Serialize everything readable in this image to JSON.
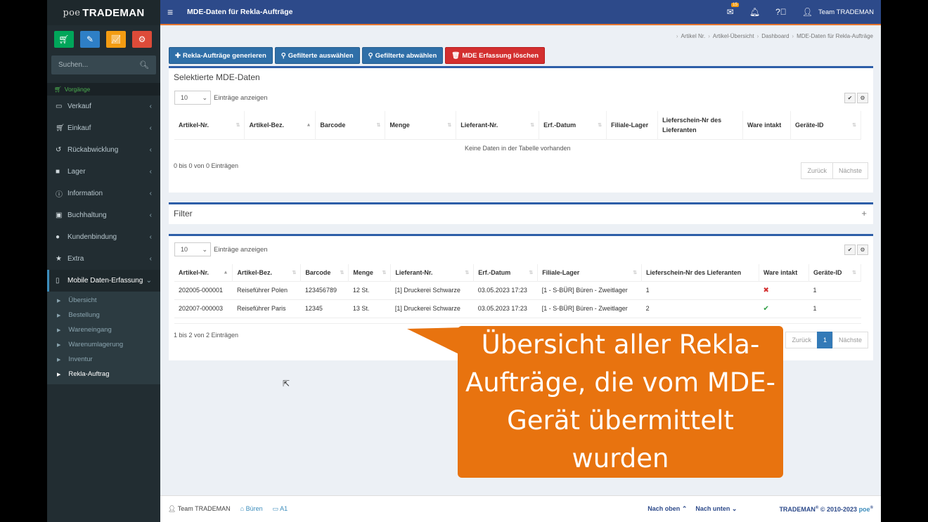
{
  "sidebar": {
    "logo_prefix": "poe",
    "logo_brand": "TRADEMAN",
    "search_placeholder": "Suchen...",
    "group_label": "Vorgänge",
    "items": [
      {
        "label": "Verkauf",
        "icon": "monitor-icon"
      },
      {
        "label": "Einkauf",
        "icon": "cart-icon"
      },
      {
        "label": "Rückabwicklung",
        "icon": "undo-icon"
      },
      {
        "label": "Lager",
        "icon": "truck-icon"
      },
      {
        "label": "Information",
        "icon": "info-icon"
      },
      {
        "label": "Buchhaltung",
        "icon": "money-icon"
      },
      {
        "label": "Kundenbindung",
        "icon": "users-icon"
      },
      {
        "label": "Extra",
        "icon": "star-icon"
      },
      {
        "label": "Mobile Daten-Erfassung",
        "icon": "mobile-icon"
      }
    ],
    "subitems": [
      "Übersicht",
      "Bestellung",
      "Wareneingang",
      "Warenumlagerung",
      "Inventur",
      "Rekla-Auftrag"
    ]
  },
  "header": {
    "title": "MDE-Daten für Rekla-Aufträge",
    "mail_badge": "15",
    "user": "Team TRADEMAN"
  },
  "breadcrumb": [
    "Artikel Nr.",
    "Artikel-Übersicht",
    "Dashboard",
    "MDE-Daten für Rekla-Aufträge"
  ],
  "actions": {
    "generate": "Rekla-Aufträge generieren",
    "select_filtered": "Gefilterte auswählen",
    "deselect_filtered": "Gefilterte abwählen",
    "delete_mde": "MDE Erfassung löschen"
  },
  "selected_box": {
    "title": "Selektierte MDE-Daten",
    "page_length": "10",
    "length_label": "Einträge anzeigen",
    "columns": [
      "Artikel-Nr.",
      "Artikel-Bez.",
      "Barcode",
      "Menge",
      "Lieferant-Nr.",
      "Erf.-Datum",
      "Filiale-Lager",
      "Lieferschein-Nr des Lieferanten",
      "Ware intakt",
      "Geräte-ID"
    ],
    "empty": "Keine Daten in der Tabelle vorhanden",
    "info": "0 bis 0 von 0 Einträgen",
    "prev": "Zurück",
    "next": "Nächste"
  },
  "filter_box": {
    "title": "Filter",
    "toggle": "+"
  },
  "main_box": {
    "page_length": "10",
    "length_label": "Einträge anzeigen",
    "columns": [
      "Artikel-Nr.",
      "Artikel-Bez.",
      "Barcode",
      "Menge",
      "Lieferant-Nr.",
      "Erf.-Datum",
      "Filiale-Lager",
      "Lieferschein-Nr des Lieferanten",
      "Ware intakt",
      "Geräte-ID"
    ],
    "rows": [
      {
        "artikel_nr": "202005-000001",
        "bez": "Reiseführer Polen",
        "barcode": "123456789",
        "menge": "12 St.",
        "lieferant": "[1] Druckerei Schwarze",
        "datum": "03.05.2023 17:23",
        "lager": "[1 - S-BÜR] Büren - Zweitlager",
        "lieferschein": "1",
        "intakt": "✖",
        "geraet": "1"
      },
      {
        "artikel_nr": "202007-000003",
        "bez": "Reiseführer Paris",
        "barcode": "12345",
        "menge": "13 St.",
        "lieferant": "[1] Druckerei Schwarze",
        "datum": "03.05.2023 17:23",
        "lager": "[1 - S-BÜR] Büren - Zweitlager",
        "lieferschein": "2",
        "intakt": "✔",
        "geraet": "1"
      }
    ],
    "info": "1 bis 2 von 2 Einträgen",
    "prev": "Zurück",
    "page": "1",
    "next": "Nächste"
  },
  "callout": "Übersicht aller Rekla-Aufträge, die vom MDE-Gerät übermittelt wurden",
  "footer": {
    "user": "Team TRADEMAN",
    "location": "Büren",
    "station": "A1",
    "to_top": "Nach oben",
    "to_bottom": "Nach unten",
    "copyright_brand": "TRADEMAN",
    "copyright_text": "© 2010-2023",
    "copyright_poe": "poe"
  },
  "colors": {
    "header": "#2d4a8a",
    "accent": "#e8772e",
    "sidebar": "#222d32",
    "callout": "#e8730f"
  }
}
